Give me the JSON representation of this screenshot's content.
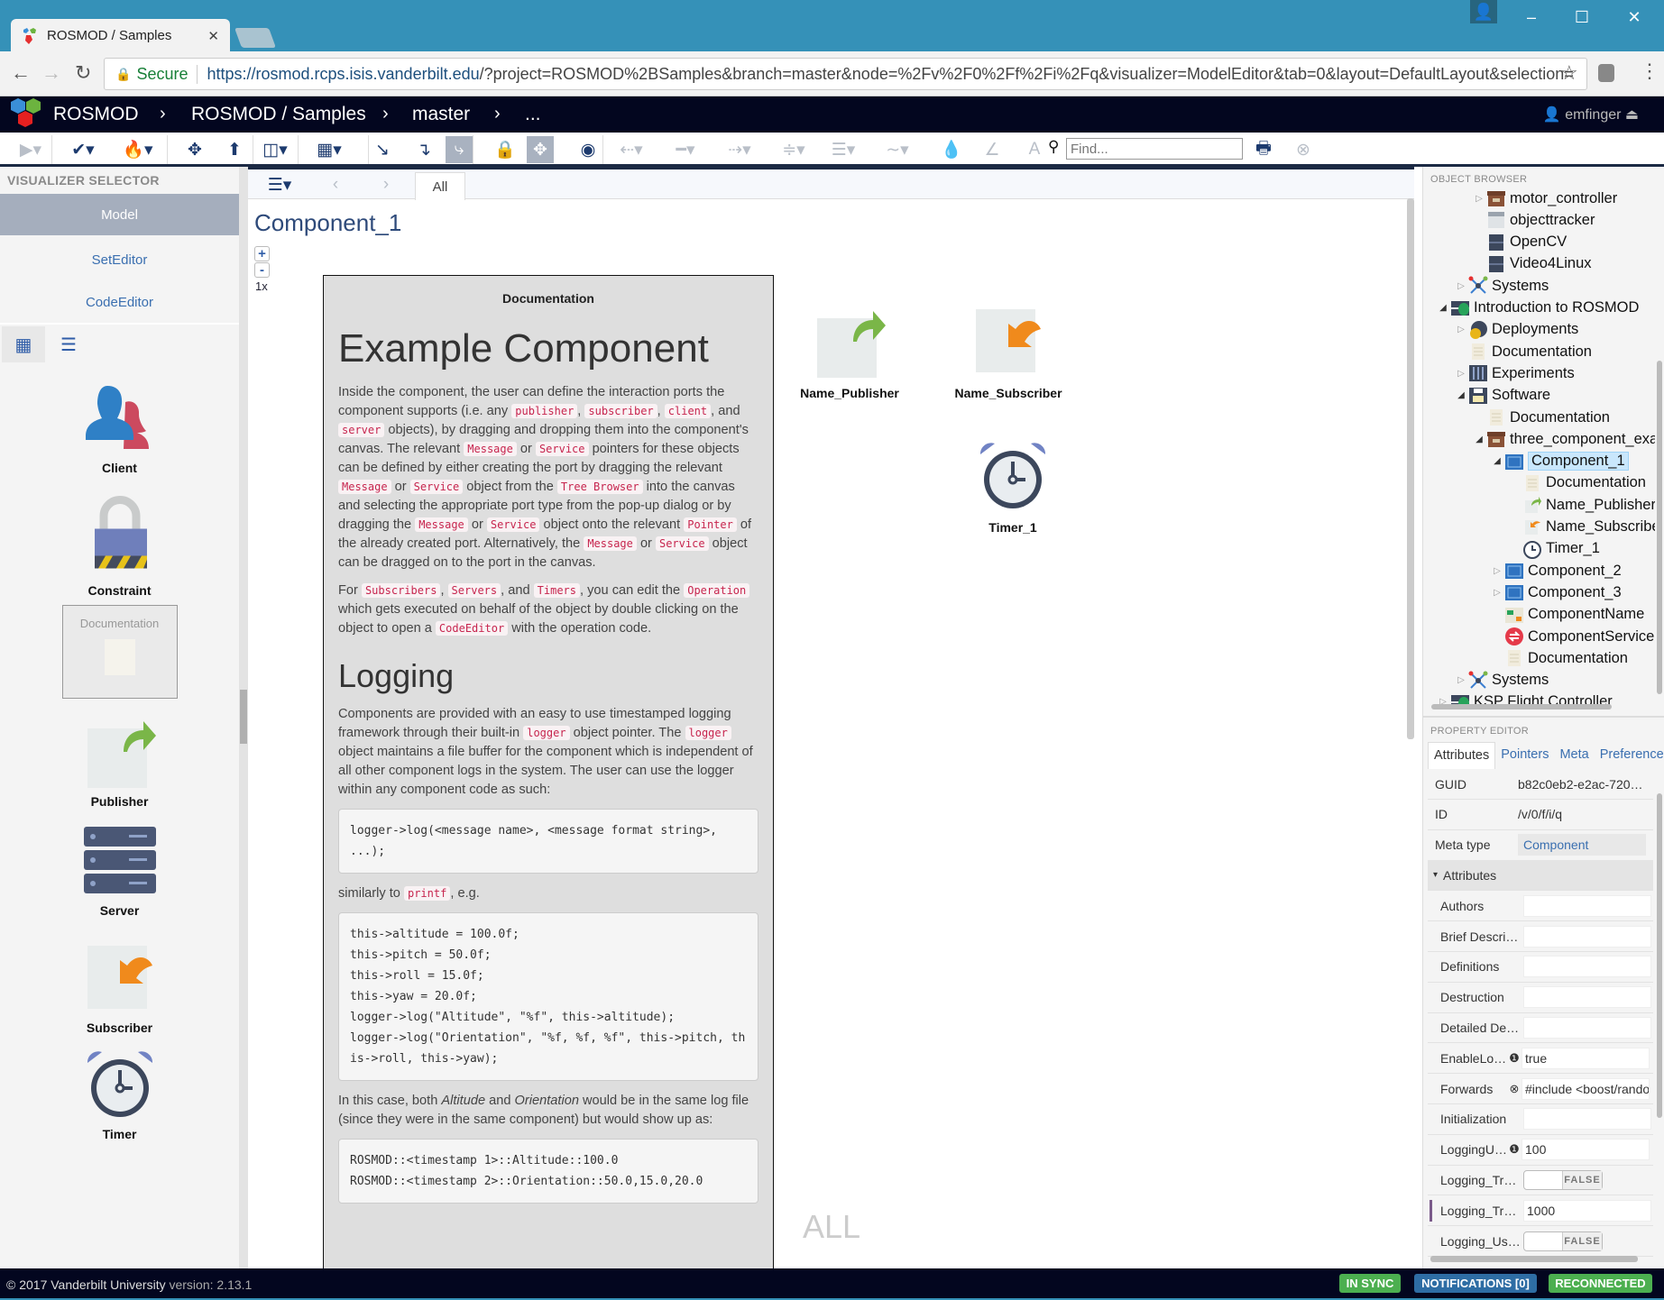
{
  "browser": {
    "tab_title": "ROSMOD / Samples",
    "secure_label": "Secure",
    "url_host": "https://rosmod.rcps.isis.vanderbilt.edu",
    "url_rest": "/?project=ROSMOD%2BSamples&branch=master&node=%2Fv%2F0%2Ff%2Fi%2Fq&visualizer=ModelEditor&tab=0&layout=DefaultLayout&selection="
  },
  "header": {
    "app_name": "ROSMOD",
    "breadcrumbs": [
      "ROSMOD / Samples",
      "master",
      "..."
    ],
    "user": "emfinger"
  },
  "toolbar": {
    "find_placeholder": "Find...",
    "icons": [
      "play-icon",
      "check-icon",
      "fire-icon",
      "move-icon",
      "upload-icon",
      "layout-icon",
      "grid-icon",
      "connect-arrow-icon",
      "elbow-arrow-icon",
      "corner-connector-icon",
      "lock-icon",
      "move-all-icon",
      "eye-icon",
      "arrow-left-icon",
      "line-style-icon",
      "arrow-right-icon",
      "align-icon",
      "line-pattern-icon",
      "curve-icon",
      "fill-color-icon",
      "pen-icon",
      "font-icon"
    ]
  },
  "left_panel": {
    "title": "VISUALIZER SELECTOR",
    "visualizers": [
      {
        "label": "Model",
        "selected": true
      },
      {
        "label": "SetEditor",
        "selected": false
      },
      {
        "label": "CodeEditor",
        "selected": false
      }
    ],
    "palette": [
      {
        "label": "Client",
        "icon": "client"
      },
      {
        "label": "Constraint",
        "icon": "constraint"
      },
      {
        "label": "Documentation",
        "icon": "documentation"
      },
      {
        "label": "Publisher",
        "icon": "publisher"
      },
      {
        "label": "Server",
        "icon": "server"
      },
      {
        "label": "Subscriber",
        "icon": "subscriber"
      },
      {
        "label": "Timer",
        "icon": "timer"
      }
    ]
  },
  "center": {
    "tab_all": "All",
    "title": "Component_1",
    "zoom_level": "1x",
    "watermark": "ALL",
    "nodes": [
      {
        "label": "Name_Publisher",
        "icon": "publisher"
      },
      {
        "label": "Name_Subscriber",
        "icon": "subscriber"
      },
      {
        "label": "Timer_1",
        "icon": "timer"
      }
    ],
    "doc": {
      "title": "Documentation",
      "h1": "Example Component",
      "p1": [
        {
          "t": "Inside the component, the user can define the interaction ports the component supports (i.e. any "
        },
        {
          "c": "publisher"
        },
        {
          "t": ", "
        },
        {
          "c": "subscriber"
        },
        {
          "t": ", "
        },
        {
          "c": "client"
        },
        {
          "t": ", and "
        },
        {
          "c": "server"
        },
        {
          "t": " objects), by dragging and dropping them into the component's canvas. The relevant "
        },
        {
          "c": "Message"
        },
        {
          "t": " or "
        },
        {
          "c": "Service"
        },
        {
          "t": " pointers for these objects can be defined by either creating the port by dragging the relevant "
        },
        {
          "c": "Message"
        },
        {
          "t": " or "
        },
        {
          "c": "Service"
        },
        {
          "t": " object from the "
        },
        {
          "c": "Tree Browser"
        },
        {
          "t": " into the canvas and selecting the appropriate port type from the pop-up dialog or by dragging the "
        },
        {
          "c": "Message"
        },
        {
          "t": " or "
        },
        {
          "c": "Service"
        },
        {
          "t": " object onto the relevant "
        },
        {
          "c": "Pointer"
        },
        {
          "t": " of the already created port. Alternatively, the "
        },
        {
          "c": "Message"
        },
        {
          "t": " or "
        },
        {
          "c": "Service"
        },
        {
          "t": " object can be dragged on to the port in the canvas."
        }
      ],
      "p2": [
        {
          "t": "For "
        },
        {
          "c": "Subscribers"
        },
        {
          "t": ", "
        },
        {
          "c": "Servers"
        },
        {
          "t": ", and "
        },
        {
          "c": "Timers"
        },
        {
          "t": ", you can edit the "
        },
        {
          "c": "Operation"
        },
        {
          "t": " which gets executed on behalf of the object by double clicking on the object to open a "
        },
        {
          "c": "CodeEditor"
        },
        {
          "t": " with the operation code."
        }
      ],
      "h2": "Logging",
      "p3": [
        {
          "t": "Components are provided with an easy to use timestamped logging framework through their built-in "
        },
        {
          "c": "logger"
        },
        {
          "t": " object pointer. The "
        },
        {
          "c": "logger"
        },
        {
          "t": " object maintains a file buffer for the component which is independent of all other component logs in the system. The user can use the logger within any component code as such:"
        }
      ],
      "code1": "logger->log(<message name>, <message format string>, ...);",
      "p4": [
        {
          "t": "similarly to "
        },
        {
          "c": "printf"
        },
        {
          "t": ", e.g."
        }
      ],
      "code2": "this->altitude = 100.0f;\nthis->pitch = 50.0f;\nthis->roll = 15.0f;\nthis->yaw = 20.0f;\nlogger->log(\"Altitude\", \"%f\", this->altitude);\nlogger->log(\"Orientation\", \"%f, %f, %f\", this->pitch, this->roll, this->yaw);",
      "p5": [
        {
          "t": "In this case, both "
        },
        {
          "i": "Altitude"
        },
        {
          "t": " and "
        },
        {
          "i": "Orientation"
        },
        {
          "t": " would be in the same log file (since they were in the same component) but would show up as:"
        }
      ],
      "code3": "ROSMOD::<timestamp 1>::Altitude::100.0\nROSMOD::<timestamp 2>::Orientation::50.0,15.0,20.0"
    }
  },
  "object_browser": {
    "title": "OBJECT BROWSER",
    "items": [
      {
        "label": "motor_controller",
        "level": 2,
        "state": "collapsed",
        "icon": "package"
      },
      {
        "label": "objecttracker",
        "level": 2,
        "state": "leaf",
        "icon": "library-light"
      },
      {
        "label": "OpenCV",
        "level": 2,
        "state": "leaf",
        "icon": "library"
      },
      {
        "label": "Video4Linux",
        "level": 2,
        "state": "leaf",
        "icon": "library"
      },
      {
        "label": "Systems",
        "level": 1,
        "state": "collapsed",
        "icon": "systems"
      },
      {
        "label": "Introduction to ROSMOD",
        "level": 0,
        "state": "expanded",
        "icon": "project"
      },
      {
        "label": "Deployments",
        "level": 1,
        "state": "collapsed",
        "icon": "deployments"
      },
      {
        "label": "Documentation",
        "level": 1,
        "state": "leaf",
        "icon": "document"
      },
      {
        "label": "Experiments",
        "level": 1,
        "state": "collapsed",
        "icon": "experiments"
      },
      {
        "label": "Software",
        "level": 1,
        "state": "expanded",
        "icon": "software"
      },
      {
        "label": "Documentation",
        "level": 2,
        "state": "leaf",
        "icon": "document"
      },
      {
        "label": "three_component_example",
        "level": 2,
        "state": "expanded",
        "icon": "package"
      },
      {
        "label": "Component_1",
        "level": 3,
        "state": "expanded",
        "icon": "component",
        "selected": true
      },
      {
        "label": "Documentation",
        "level": 4,
        "state": "leaf",
        "icon": "document"
      },
      {
        "label": "Name_Publisher",
        "level": 4,
        "state": "leaf",
        "icon": "publisher"
      },
      {
        "label": "Name_Subscriber",
        "level": 4,
        "state": "leaf",
        "icon": "subscriber"
      },
      {
        "label": "Timer_1",
        "level": 4,
        "state": "leaf",
        "icon": "timer"
      },
      {
        "label": "Component_2",
        "level": 3,
        "state": "collapsed",
        "icon": "component"
      },
      {
        "label": "Component_3",
        "level": 3,
        "state": "collapsed",
        "icon": "component"
      },
      {
        "label": "ComponentName",
        "level": 3,
        "state": "leaf",
        "icon": "message"
      },
      {
        "label": "ComponentService",
        "level": 3,
        "state": "leaf",
        "icon": "service"
      },
      {
        "label": "Documentation",
        "level": 3,
        "state": "leaf",
        "icon": "document"
      },
      {
        "label": "Systems",
        "level": 1,
        "state": "collapsed",
        "icon": "systems"
      },
      {
        "label": "KSP Flight Controller",
        "level": 0,
        "state": "collapsed",
        "icon": "project"
      }
    ]
  },
  "property_editor": {
    "title": "PROPERTY EDITOR",
    "tabs": [
      "Attributes",
      "Pointers",
      "Meta",
      "Preferences"
    ],
    "active_tab": "Attributes",
    "rows": [
      {
        "label": "GUID",
        "value": "b82c0eb2-e2ac-720…",
        "kind": "text"
      },
      {
        "label": "ID",
        "value": "/v/0/f/i/q",
        "kind": "text"
      },
      {
        "label": "Meta type",
        "value": "Component",
        "kind": "link"
      },
      {
        "label": "Attributes",
        "kind": "group"
      },
      {
        "label": "Authors",
        "value": "",
        "kind": "input"
      },
      {
        "label": "Brief Descrip…",
        "value": "",
        "kind": "input"
      },
      {
        "label": "Definitions",
        "value": "",
        "kind": "input"
      },
      {
        "label": "Destruction",
        "value": "",
        "kind": "input"
      },
      {
        "label": "Detailed Des…",
        "value": "",
        "kind": "input"
      },
      {
        "label": "EnableLo…",
        "value": "true",
        "kind": "input",
        "badge": "warning-icon"
      },
      {
        "label": "Forwards",
        "value": "#include <boost/random",
        "kind": "input",
        "badge": "reset-icon"
      },
      {
        "label": "Initialization",
        "value": "",
        "kind": "input"
      },
      {
        "label": "LoggingU…",
        "value": "100",
        "kind": "input",
        "badge": "warning-icon"
      },
      {
        "label": "Logging_Tra…",
        "value": "FALSE",
        "kind": "toggle"
      },
      {
        "label": "Logging_Tra…",
        "value": "1000",
        "kind": "input",
        "marked": true
      },
      {
        "label": "Logging_Us…",
        "value": "FALSE",
        "kind": "toggle"
      }
    ]
  },
  "footer": {
    "copyright": "© 2017 Vanderbilt University",
    "version_label": "version:",
    "version": "2.13.1",
    "badges": [
      {
        "label": "IN SYNC",
        "color": "#4caf50"
      },
      {
        "label": "NOTIFICATIONS [0]",
        "color": "#2e6da4"
      },
      {
        "label": "RECONNECTED",
        "color": "#4caf50"
      }
    ]
  },
  "colors": {
    "header_bg": "#03061f",
    "chrome_bg": "#3591b8",
    "selection": "#c9e7fc",
    "code_text": "#c7254e"
  }
}
